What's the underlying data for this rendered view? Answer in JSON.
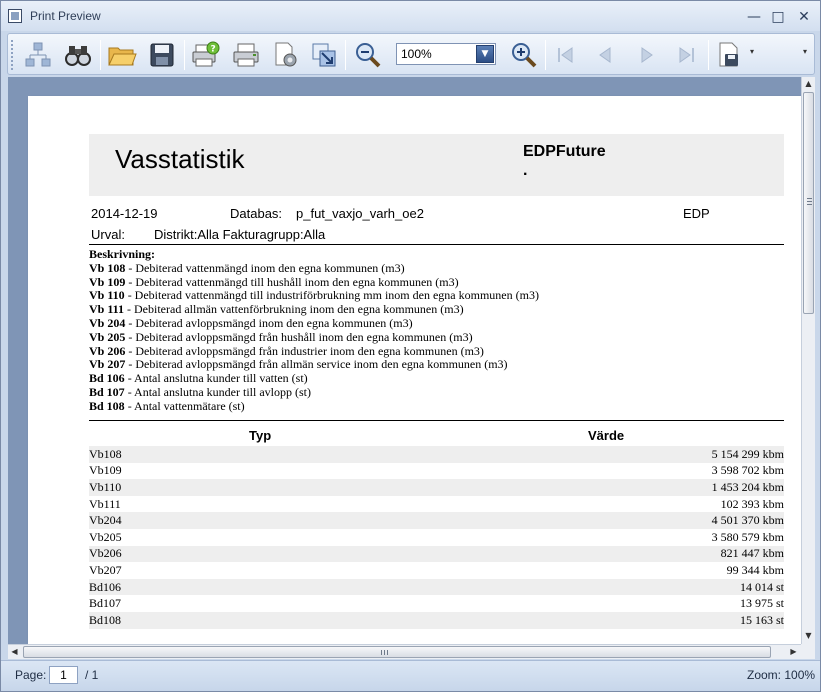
{
  "window": {
    "title": "Print Preview",
    "minimize_glyph": "—",
    "maximize_glyph": "□",
    "close_glyph": "✕"
  },
  "toolbar": {
    "zoom_value": "100%",
    "icons": [
      "document-map-icon",
      "binoculars-icon",
      "open-folder-icon",
      "save-icon",
      "print-dialog-icon",
      "print-icon",
      "page-setup-icon",
      "export-icon",
      "zoom-out-icon",
      "zoom-in-icon",
      "first-page-icon",
      "previous-page-icon",
      "next-page-icon",
      "last-page-icon",
      "export-document-icon"
    ]
  },
  "report": {
    "title": "Vasstatistik",
    "company": "EDPFuture",
    "company_dot": ".",
    "date": "2014-12-19",
    "database_label": "Databas:",
    "database_value": "p_fut_vaxjo_varh_oe2",
    "edp": "EDP",
    "urval_label": "Urval:",
    "urval_value": "Distrikt:Alla Fakturagrupp:Alla",
    "description_heading": "Beskrivning:",
    "descriptions": [
      {
        "code": "Vb 108",
        "text": " - Debiterad vattenmängd inom den egna kommunen (m3)"
      },
      {
        "code": "Vb 109",
        "text": " - Debiterad vattenmängd till hushåll inom den egna kommunen (m3)"
      },
      {
        "code": "Vb 110",
        "text": " - Debiterad vattenmängd till industriförbrukning mm inom den egna kommunen (m3)"
      },
      {
        "code": "Vb 111",
        "text": " - Debiterad allmän vattenförbrukning inom den egna kommunen (m3)"
      },
      {
        "code": "Vb 204",
        "text": " - Debiterad avloppsmängd inom den egna kommunen (m3)"
      },
      {
        "code": "Vb 205",
        "text": " - Debiterad avloppsmängd från hushåll inom den egna kommunen (m3)"
      },
      {
        "code": "Vb 206",
        "text": " - Debiterad avloppsmängd från industrier inom den egna kommunen (m3)"
      },
      {
        "code": "Vb 207",
        "text": " - Debiterad avloppsmängd från allmän service inom den egna kommunen (m3)"
      },
      {
        "code": "Bd 106",
        "text": " - Antal anslutna kunder till vatten (st)"
      },
      {
        "code": "Bd 107",
        "text": " - Antal anslutna kunder till avlopp (st)"
      },
      {
        "code": "Bd 108",
        "text": " - Antal vattenmätare (st)"
      }
    ],
    "table": {
      "col_typ": "Typ",
      "col_varde": "Värde",
      "rows": [
        {
          "typ": "Vb108",
          "varde": "5 154 299 kbm"
        },
        {
          "typ": "Vb109",
          "varde": "3 598 702 kbm"
        },
        {
          "typ": "Vb110",
          "varde": "1 453 204 kbm"
        },
        {
          "typ": "Vb111",
          "varde": "102 393 kbm"
        },
        {
          "typ": "Vb204",
          "varde": "4 501 370 kbm"
        },
        {
          "typ": "Vb205",
          "varde": "3 580 579 kbm"
        },
        {
          "typ": "Vb206",
          "varde": "821 447 kbm"
        },
        {
          "typ": "Vb207",
          "varde": "99 344 kbm"
        },
        {
          "typ": "Bd106",
          "varde": "14 014 st"
        },
        {
          "typ": "Bd107",
          "varde": "13 975 st"
        },
        {
          "typ": "Bd108",
          "varde": "15 163 st"
        }
      ]
    }
  },
  "statusbar": {
    "page_label": "Page:",
    "page_value": "1",
    "page_total": "/ 1",
    "zoom": "Zoom: 100%"
  }
}
